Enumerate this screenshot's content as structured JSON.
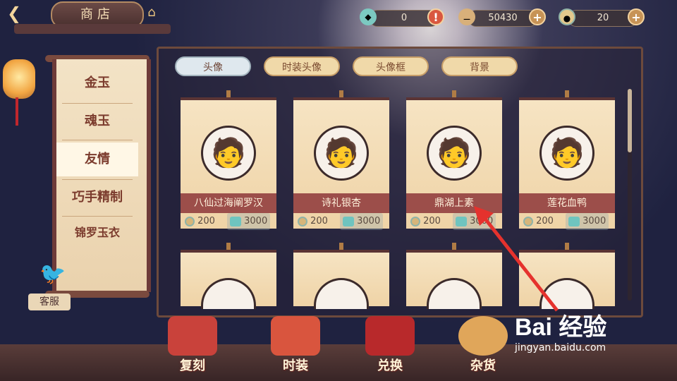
{
  "header": {
    "back_icon": "back-arrow-icon",
    "shop_label": "商店",
    "home_icon": "home-icon",
    "resources": [
      {
        "name": "jade",
        "icon": "jade-icon",
        "value": "0",
        "action_icon": "warning-icon",
        "action_symbol": "!"
      },
      {
        "name": "gold",
        "icon": "gold-icon",
        "value": "50430",
        "action_icon": "plus-icon",
        "action_symbol": "+"
      },
      {
        "name": "coin",
        "icon": "coin-icon",
        "value": "20",
        "action_icon": "plus-icon",
        "action_symbol": "+"
      }
    ]
  },
  "sidebar": {
    "items": [
      {
        "label": "金玉",
        "active": false
      },
      {
        "label": "魂玉",
        "active": false
      },
      {
        "label": "友情",
        "active": true
      },
      {
        "label": "巧手精制",
        "active": false
      },
      {
        "label": "锦罗玉衣",
        "active": false
      }
    ],
    "service_label": "客服"
  },
  "tabs": [
    {
      "label": "头像",
      "active": true
    },
    {
      "label": "时装头像",
      "active": false
    },
    {
      "label": "头像框",
      "active": false
    },
    {
      "label": "背景",
      "active": false
    }
  ],
  "cards": [
    {
      "name": "八仙过海阐罗汉",
      "coin_price": "200",
      "jade_price": "3000"
    },
    {
      "name": "诗礼银杏",
      "coin_price": "200",
      "jade_price": "3000"
    },
    {
      "name": "鼎湖上素",
      "coin_price": "200",
      "jade_price": "3000"
    },
    {
      "name": "莲花血鸭",
      "coin_price": "200",
      "jade_price": "3000"
    }
  ],
  "bottom_nav": [
    {
      "label": "复刻",
      "color": "#c9423b"
    },
    {
      "label": "时装",
      "color": "#d9553e"
    },
    {
      "label": "兑换",
      "color": "#b8292b"
    },
    {
      "label": "杂货",
      "color": "#e0a65a"
    }
  ],
  "watermark": {
    "logo": "Bai 经验",
    "url": "jingyan.baidu.com"
  },
  "colors": {
    "accent": "#9c4e4a",
    "frame": "#6d4a3c",
    "arrow": "#e5322d"
  }
}
